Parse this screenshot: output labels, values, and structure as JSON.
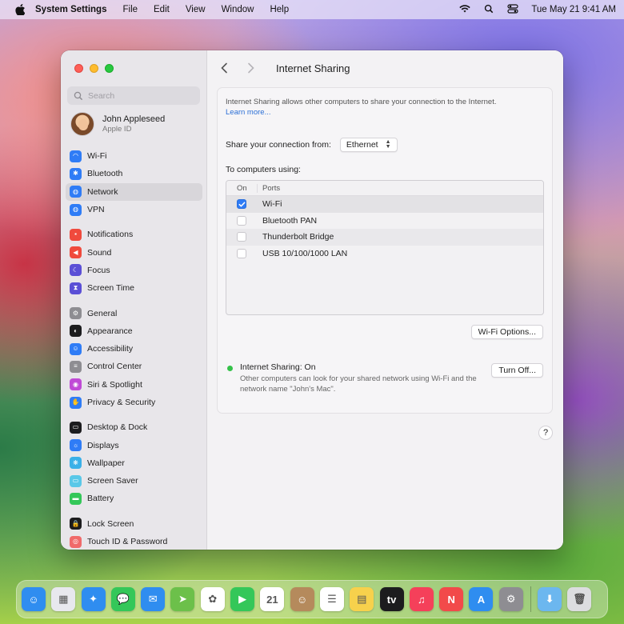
{
  "menubar": {
    "app_name": "System Settings",
    "menus": [
      "File",
      "Edit",
      "View",
      "Window",
      "Help"
    ],
    "datetime": "Tue May 21  9:41 AM"
  },
  "sidebar": {
    "search_placeholder": "Search",
    "user": {
      "name": "John Appleseed",
      "subtitle": "Apple ID"
    },
    "groups": [
      [
        {
          "label": "Wi-Fi",
          "icon": "wifi-icon",
          "color": "#2f7cf6",
          "glyph": "◠"
        },
        {
          "label": "Bluetooth",
          "icon": "bluetooth-icon",
          "color": "#2f7cf6",
          "glyph": "✱"
        },
        {
          "label": "Network",
          "icon": "network-globe-icon",
          "color": "#2f7cf6",
          "glyph": "◍",
          "selected": true
        },
        {
          "label": "VPN",
          "icon": "vpn-globe-icon",
          "color": "#2f7cf6",
          "glyph": "◍"
        }
      ],
      [
        {
          "label": "Notifications",
          "icon": "notifications-icon",
          "color": "#f04a3d",
          "glyph": "▪"
        },
        {
          "label": "Sound",
          "icon": "sound-icon",
          "color": "#f04a3d",
          "glyph": "◀"
        },
        {
          "label": "Focus",
          "icon": "focus-moon-icon",
          "color": "#5b4fd6",
          "glyph": "☾"
        },
        {
          "label": "Screen Time",
          "icon": "screen-time-icon",
          "color": "#5b4fd6",
          "glyph": "⧗"
        }
      ],
      [
        {
          "label": "General",
          "icon": "general-gear-icon",
          "color": "#8e8d92",
          "glyph": "⚙"
        },
        {
          "label": "Appearance",
          "icon": "appearance-icon",
          "color": "#1c1c1e",
          "glyph": "◐"
        },
        {
          "label": "Accessibility",
          "icon": "accessibility-icon",
          "color": "#2f7cf6",
          "glyph": "☺"
        },
        {
          "label": "Control Center",
          "icon": "control-center-icon",
          "color": "#8e8d92",
          "glyph": "≡"
        },
        {
          "label": "Siri & Spotlight",
          "icon": "siri-icon",
          "color": "#c04ad6",
          "glyph": "◉"
        },
        {
          "label": "Privacy & Security",
          "icon": "privacy-hand-icon",
          "color": "#2f7cf6",
          "glyph": "✋"
        }
      ],
      [
        {
          "label": "Desktop & Dock",
          "icon": "desktop-dock-icon",
          "color": "#1c1c1e",
          "glyph": "▭"
        },
        {
          "label": "Displays",
          "icon": "displays-icon",
          "color": "#2f7cf6",
          "glyph": "☼"
        },
        {
          "label": "Wallpaper",
          "icon": "wallpaper-icon",
          "color": "#3ab0e8",
          "glyph": "❋"
        },
        {
          "label": "Screen Saver",
          "icon": "screen-saver-icon",
          "color": "#5ac8e8",
          "glyph": "▭"
        },
        {
          "label": "Battery",
          "icon": "battery-icon",
          "color": "#34c759",
          "glyph": "▬"
        }
      ],
      [
        {
          "label": "Lock Screen",
          "icon": "lock-icon",
          "color": "#1c1c1e",
          "glyph": "🔒"
        },
        {
          "label": "Touch ID & Password",
          "icon": "fingerprint-icon",
          "color": "#f06a6a",
          "glyph": "◎"
        }
      ]
    ]
  },
  "main": {
    "title": "Internet Sharing",
    "description": "Internet Sharing allows other computers to share your connection to the Internet.",
    "learn_more": "Learn more...",
    "share_label": "Share your connection from:",
    "share_value": "Ethernet",
    "to_label": "To computers using:",
    "columns": {
      "on": "On",
      "ports": "Ports"
    },
    "ports": [
      {
        "name": "Wi-Fi",
        "checked": true
      },
      {
        "name": "Bluetooth PAN",
        "checked": false
      },
      {
        "name": "Thunderbolt Bridge",
        "checked": false
      },
      {
        "name": "USB 10/100/1000 LAN",
        "checked": false
      }
    ],
    "wifi_options_label": "Wi-Fi Options...",
    "status_title": "Internet Sharing: On",
    "status_sub": "Other computers can look for your shared network using Wi-Fi and the network name \"John's Mac\".",
    "turn_off_label": "Turn Off...",
    "help_label": "?"
  },
  "dock": {
    "apps": [
      {
        "name": "finder-icon",
        "color": "#2f8df0",
        "glyph": "☺"
      },
      {
        "name": "launchpad-icon",
        "color": "#e8e8ee",
        "glyph": "▦"
      },
      {
        "name": "safari-icon",
        "color": "#2f8df0",
        "glyph": "✦"
      },
      {
        "name": "messages-icon",
        "color": "#34c759",
        "glyph": "💬"
      },
      {
        "name": "mail-icon",
        "color": "#2f8df0",
        "glyph": "✉"
      },
      {
        "name": "maps-icon",
        "color": "#6cc04a",
        "glyph": "➤"
      },
      {
        "name": "photos-icon",
        "color": "#ffffff",
        "glyph": "✿"
      },
      {
        "name": "facetime-icon",
        "color": "#34c759",
        "glyph": "▶"
      },
      {
        "name": "calendar-icon",
        "color": "#ffffff",
        "glyph": "21"
      },
      {
        "name": "contacts-icon",
        "color": "#b58a5c",
        "glyph": "☺"
      },
      {
        "name": "reminders-icon",
        "color": "#ffffff",
        "glyph": "☰"
      },
      {
        "name": "notes-icon",
        "color": "#f7d14c",
        "glyph": "▤"
      },
      {
        "name": "apple-tv-icon",
        "color": "#1c1c1e",
        "glyph": "tv"
      },
      {
        "name": "music-icon",
        "color": "#f5405a",
        "glyph": "♫"
      },
      {
        "name": "news-icon",
        "color": "#f24a4a",
        "glyph": "N"
      },
      {
        "name": "app-store-icon",
        "color": "#2f8df0",
        "glyph": "A"
      },
      {
        "name": "system-settings-icon",
        "color": "#8e8d92",
        "glyph": "⚙"
      }
    ],
    "right": [
      {
        "name": "downloads-folder-icon",
        "color": "#6cb7ef",
        "glyph": "⬇"
      },
      {
        "name": "trash-icon",
        "color": "#dcdde0",
        "glyph": "🗑"
      }
    ]
  }
}
